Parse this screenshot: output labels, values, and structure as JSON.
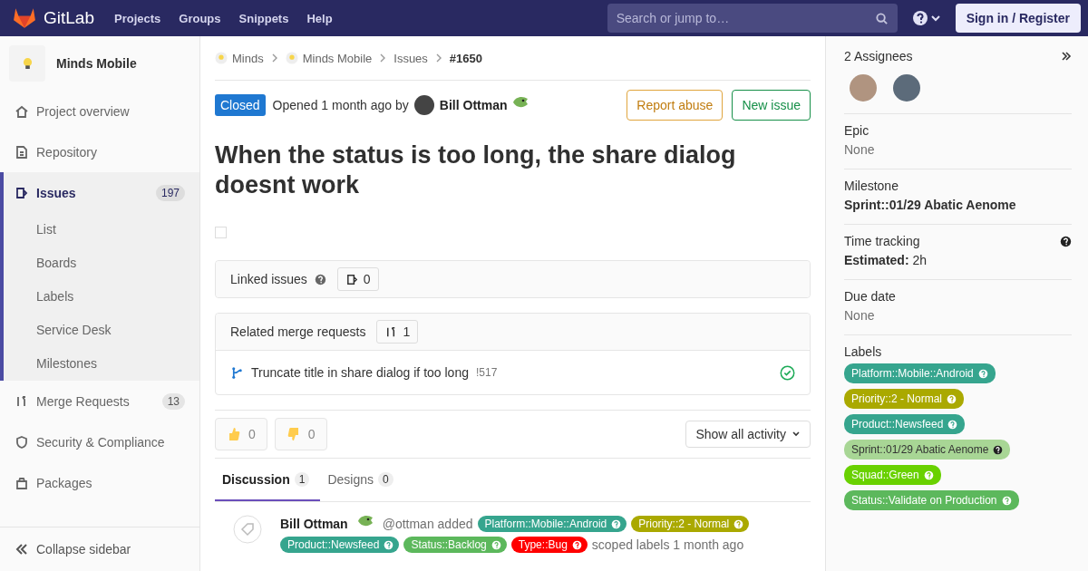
{
  "topbar": {
    "brand": "GitLab",
    "nav": [
      "Projects",
      "Groups",
      "Snippets",
      "Help"
    ],
    "search": {
      "placeholder": "Search or jump to…"
    },
    "sign_in": "Sign in / Register"
  },
  "sidebar": {
    "project": "Minds Mobile",
    "items": [
      {
        "label": "Project overview",
        "selected": false
      },
      {
        "label": "Repository",
        "selected": false
      },
      {
        "label": "Issues",
        "selected": true,
        "count": "197",
        "expanded": true,
        "children": [
          {
            "label": "List"
          },
          {
            "label": "Boards"
          },
          {
            "label": "Labels"
          },
          {
            "label": "Service Desk"
          },
          {
            "label": "Milestones"
          }
        ]
      },
      {
        "label": "Merge Requests",
        "selected": false,
        "count": "13"
      },
      {
        "label": "Security & Compliance",
        "selected": false
      },
      {
        "label": "Packages",
        "selected": false
      }
    ],
    "collapse": "Collapse sidebar"
  },
  "breadcrumb": [
    {
      "label": "Minds",
      "avatar": true
    },
    {
      "label": "Minds Mobile",
      "avatar": true
    },
    {
      "label": "Issues",
      "avatar": false
    },
    {
      "label": "#1650",
      "avatar": false
    }
  ],
  "issue": {
    "status": "Closed",
    "opened": "Opened 1 month ago by",
    "author": "Bill Ottman",
    "actions": [
      {
        "label": "Report abuse",
        "kind": "warning"
      },
      {
        "label": "New issue",
        "kind": "success"
      }
    ],
    "title": "When the status is too long, the share dialog doesnt work",
    "task_checkbox": {
      "checked": false
    }
  },
  "linked_issues": {
    "title": "Linked issues",
    "count": "0"
  },
  "related_mrs": {
    "title": "Related merge requests",
    "count": "1",
    "items": [
      {
        "title": "Truncate title in share dialog if too long",
        "ref": "!517"
      }
    ]
  },
  "awards": [
    {
      "kind": "up",
      "count": "0"
    },
    {
      "kind": "down",
      "count": "0"
    }
  ],
  "activity_filter": "Show all activity",
  "tabs": [
    {
      "label": "Discussion",
      "count": "1",
      "selected": true
    },
    {
      "label": "Designs",
      "count": "0",
      "selected": false
    }
  ],
  "note": {
    "author": "Bill Ottman",
    "handle": "@ottman added",
    "suffix": "scoped labels 1 month ago",
    "labels": [
      {
        "text": "Platform::Mobile::Android",
        "color": "#36a58e"
      },
      {
        "text": "Priority::2 - Normal",
        "color": "#aaa900"
      },
      {
        "text": "Product::Newsfeed",
        "color": "#36a58e"
      },
      {
        "text": "Status::Backlog",
        "color": "#5cb85c"
      },
      {
        "text": "Type::Bug",
        "color": "#ff0000"
      }
    ]
  },
  "right_sidebar": {
    "assignees": "2 Assignees",
    "epic": {
      "title": "Epic",
      "value": "None"
    },
    "milestone": {
      "title": "Milestone",
      "value": "Sprint::01/29 Abatic Aenome"
    },
    "time": {
      "title": "Time tracking",
      "key": "Estimated:",
      "value": "2h"
    },
    "due": {
      "title": "Due date",
      "value": "None"
    },
    "labels_title": "Labels",
    "labels": [
      {
        "text": "Platform::Mobile::Android",
        "color": "#36a58e",
        "dark": false
      },
      {
        "text": "Priority::2 - Normal",
        "color": "#aaa900",
        "dark": false
      },
      {
        "text": "Product::Newsfeed",
        "color": "#36a58e",
        "dark": false
      },
      {
        "text": "Sprint::01/29 Abatic Aenome",
        "color": "#a8d695",
        "dark": true
      },
      {
        "text": "Squad::Green",
        "color": "#69d100",
        "dark": false
      },
      {
        "text": "Status::Validate on Production",
        "color": "#5cb85c",
        "dark": false
      }
    ]
  }
}
